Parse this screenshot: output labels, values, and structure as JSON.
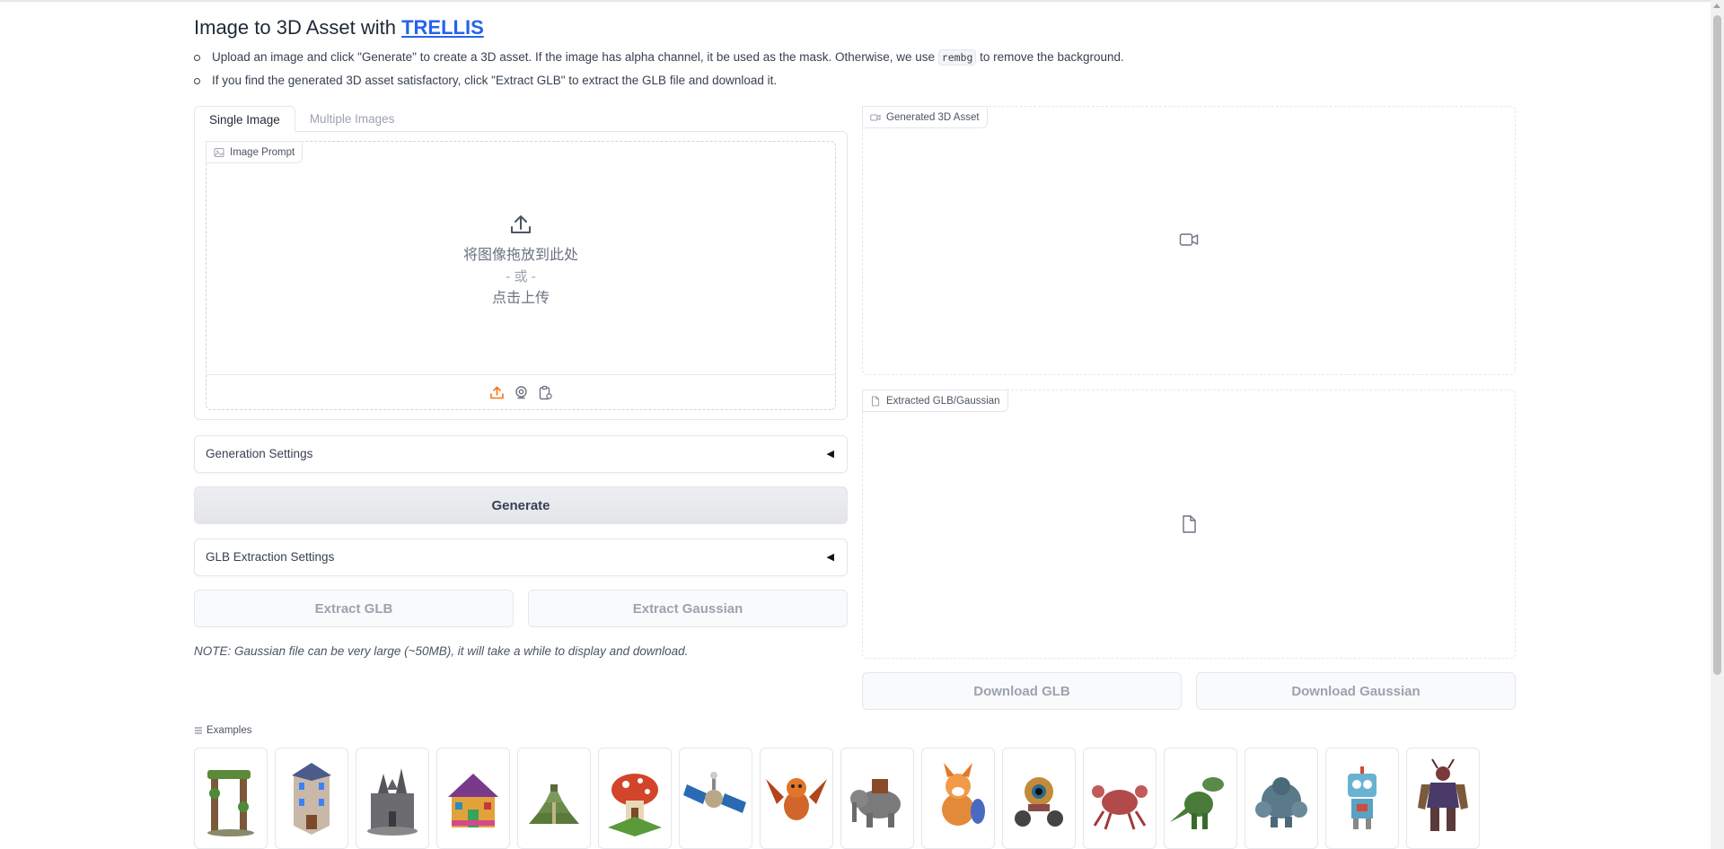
{
  "title": {
    "prefix": "Image to 3D Asset with ",
    "link": "TRELLIS"
  },
  "instructions": {
    "line1_before": "Upload an image and click \"Generate\" to create a 3D asset. If the image has alpha channel, it be used as the mask. Otherwise, we use ",
    "line1_code": "rembg",
    "line1_after": " to remove the background.",
    "line2": "If you find the generated 3D asset satisfactory, click \"Extract GLB\" to extract the GLB file and download it."
  },
  "tabs": [
    {
      "label": "Single Image",
      "active": true
    },
    {
      "label": "Multiple Images",
      "active": false
    }
  ],
  "image_prompt": {
    "label": "Image Prompt",
    "drop_text": "将图像拖放到此处",
    "or_text": "- 或 -",
    "click_text": "点击上传",
    "tools": [
      "upload-icon",
      "webcam-icon",
      "clipboard-icon"
    ]
  },
  "generation_settings": {
    "label": "Generation Settings",
    "arrow": "◀"
  },
  "generate_button": "Generate",
  "glb_settings": {
    "label": "GLB Extraction Settings",
    "arrow": "◀"
  },
  "extract_glb_button": "Extract GLB",
  "extract_gaussian_button": "Extract Gaussian",
  "note": "NOTE: Gaussian file can be very large (~50MB), it will take a while to display and download.",
  "video_panel": {
    "label": "Generated 3D Asset",
    "icon": "video-icon"
  },
  "file_panel": {
    "label": "Extracted GLB/Gaussian",
    "icon": "file-icon"
  },
  "download_glb_button": "Download GLB",
  "download_gaussian_button": "Download Gaussian",
  "examples": {
    "label": "Examples",
    "items": [
      "vine-arch",
      "tower-building",
      "stone-castle",
      "colorful-house",
      "step-pyramid",
      "mushroom-house",
      "satellite",
      "orange-dragon",
      "war-elephant",
      "fox-creature",
      "wheeled-robot",
      "red-crab",
      "green-dinosaur",
      "rock-golem",
      "blue-robot",
      "armored-warrior"
    ]
  },
  "colors": {
    "accent_link": "#2563eb",
    "upload_icon": "#f97316",
    "border": "#e5e7eb"
  }
}
